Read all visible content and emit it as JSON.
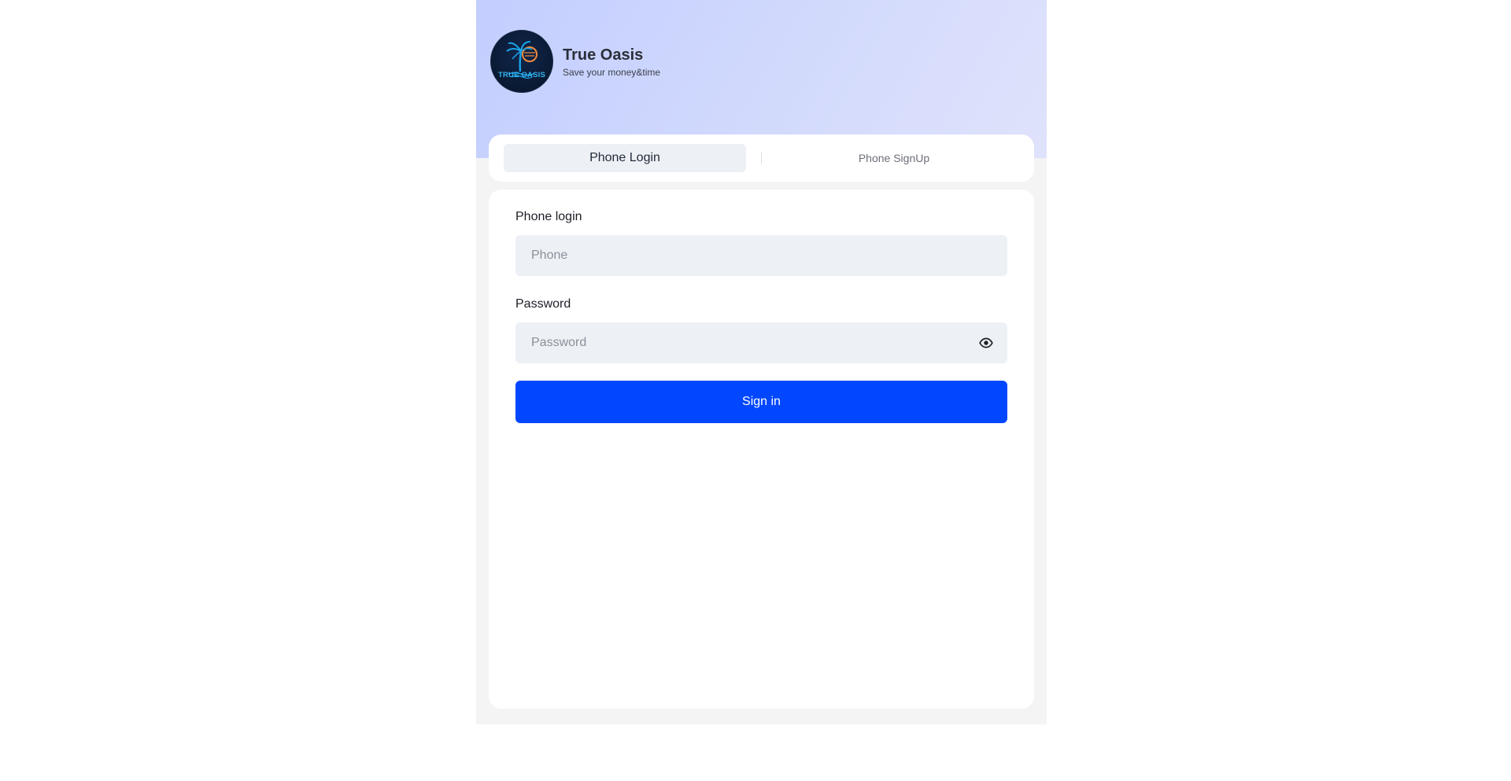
{
  "brand": {
    "name": "True Oasis",
    "slogan": "Save your money&time",
    "logo_text": "TRUE OASIS"
  },
  "tabs": [
    {
      "label": "Phone Login",
      "active": true
    },
    {
      "label": "Phone SignUp",
      "active": false
    }
  ],
  "form": {
    "phone_label": "Phone login",
    "phone_placeholder": "Phone",
    "password_label": "Password",
    "password_placeholder": "Password",
    "password_toggle_icon": "eye-icon",
    "submit_label": "Sign in"
  },
  "colors": {
    "accent": "#0047ff",
    "hero_gradient_start": "#c3ceff",
    "hero_gradient_end": "#dfe2fb",
    "field_background": "#edf0f5"
  }
}
